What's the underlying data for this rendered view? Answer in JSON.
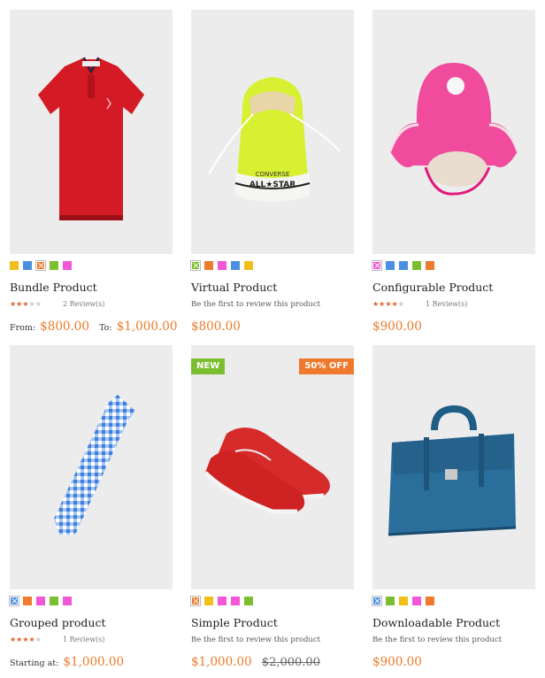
{
  "products": [
    {
      "name": "Bundle Product",
      "rating": 3,
      "reviews": "2 Review(s)",
      "from_label": "From:",
      "from_price": "$800.00",
      "to_label": "To:",
      "to_price": "$1,000.00",
      "swatches": [
        "#f2be1a",
        "#4b8fe0",
        "#ef7a2e",
        "#7dbe31",
        "#f257d8"
      ]
    },
    {
      "name": "Virtual Product",
      "first_review": "Be the first to review this product",
      "price": "$800.00",
      "swatches": [
        "#7dbe31",
        "#ef7a2e",
        "#f257d8",
        "#4b8fe0",
        "#f2be1a"
      ]
    },
    {
      "name": "Configurable Product",
      "rating": 4,
      "reviews": "1 Review(s)",
      "price": "$900.00",
      "swatches": [
        "#f257d8",
        "#4b8fe0",
        "#4b8fe0",
        "#7dbe31",
        "#ef7a2e"
      ]
    },
    {
      "name": "Grouped product",
      "rating": 4,
      "reviews": "1 Review(s)",
      "starting_label": "Starting at:",
      "price": "$1,000.00",
      "swatches": [
        "#4b8fe0",
        "#ef7a2e",
        "#f257d8",
        "#7dbe31",
        "#f257d8"
      ]
    },
    {
      "name": "Simple Product",
      "first_review": "Be the first to review this product",
      "price": "$1,000.00",
      "old_price": "$2,000.00",
      "badge_new": "NEW",
      "badge_sale": "50% OFF",
      "swatches": [
        "#ef7a2e",
        "#f2be1a",
        "#f257d8",
        "#f257d8",
        "#7dbe31"
      ]
    },
    {
      "name": "Downloadable Product",
      "first_review": "Be the first to review this product",
      "price": "$900.00",
      "swatches": [
        "#4b8fe0",
        "#7dbe31",
        "#f2be1a",
        "#f257d8",
        "#ef7a2e"
      ]
    }
  ],
  "images": [
    "red-polo-shirt",
    "yellow-converse-sneaker",
    "pink-bucket-hat",
    "blue-gingham-tie",
    "red-boat-shoes",
    "blue-leather-briefcase"
  ]
}
